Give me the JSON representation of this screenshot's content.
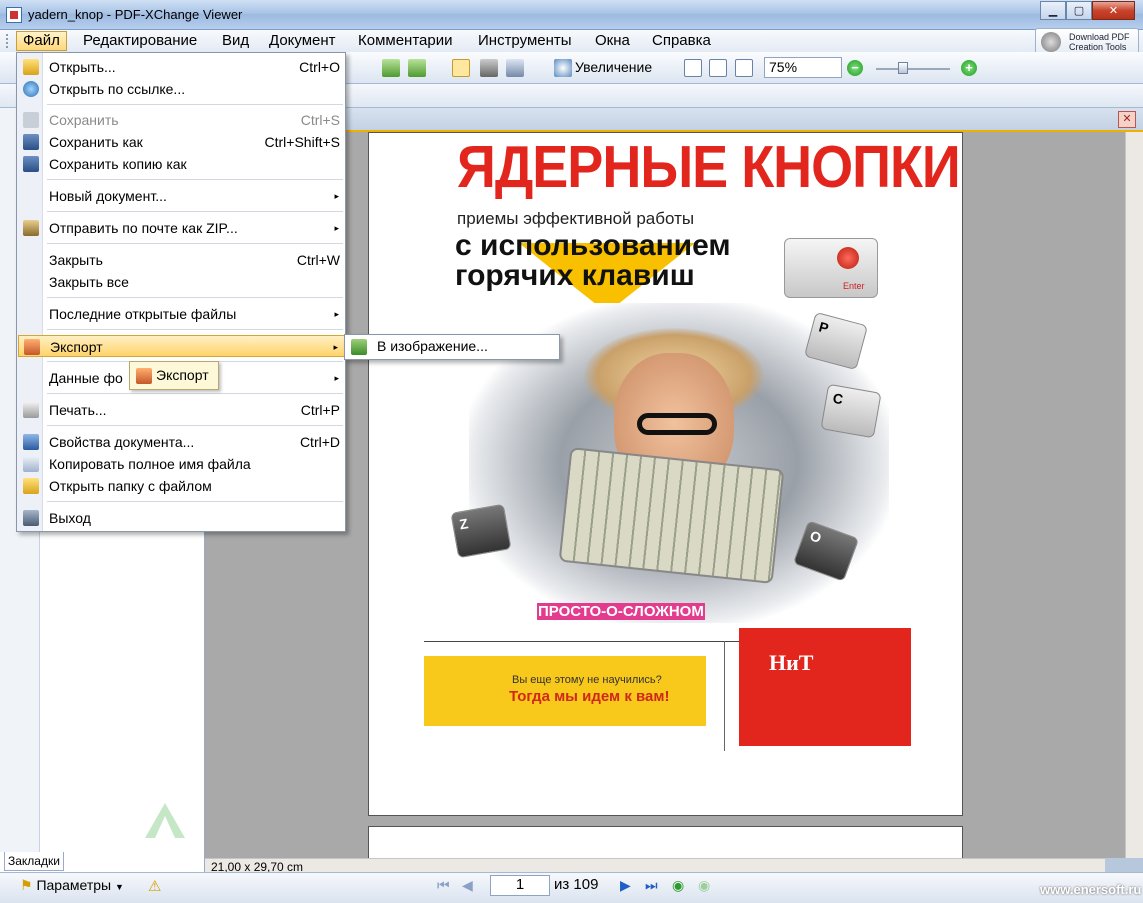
{
  "window": {
    "title": "yadern_knop - PDF-XChange Viewer"
  },
  "menubar": {
    "items": [
      "Файл",
      "Редактирование",
      "Вид",
      "Документ",
      "Комментарии",
      "Инструменты",
      "Окна",
      "Справка"
    ],
    "download_btn": [
      "Download PDF",
      "Creation Tools"
    ]
  },
  "toolbar": {
    "zoom_label": "Увеличение",
    "zoom_value": "75%"
  },
  "file_menu": {
    "items": [
      {
        "label": "Открыть...",
        "shortcut": "Ctrl+O"
      },
      {
        "label": "Открыть по ссылке..."
      },
      {
        "label": "Сохранить",
        "shortcut": "Ctrl+S"
      },
      {
        "label": "Сохранить как",
        "shortcut": "Ctrl+Shift+S"
      },
      {
        "label": "Сохранить копию как"
      },
      {
        "label": "Новый документ..."
      },
      {
        "label": "Отправить по почте как ZIP..."
      },
      {
        "label": "Закрыть",
        "shortcut": "Ctrl+W"
      },
      {
        "label": "Закрыть все"
      },
      {
        "label": "Последние открытые файлы"
      },
      {
        "label": "Экспорт"
      },
      {
        "label": "Данные фо"
      },
      {
        "label": "Печать...",
        "shortcut": "Ctrl+P"
      },
      {
        "label": "Свойства документа...",
        "shortcut": "Ctrl+D"
      },
      {
        "label": "Копировать полное имя файла"
      },
      {
        "label": "Открыть папку с файлом"
      },
      {
        "label": "Выход"
      }
    ],
    "export_submenu": "В изображение...",
    "tooltip": "Экспорт"
  },
  "left_pane": {
    "tab_label": "Закладки"
  },
  "document": {
    "title": "ЯДЕРНЫЕ КНОПКИ",
    "subtitle": "приемы эффективной работы",
    "line1": "с использованием",
    "line2": "горячих клавиш",
    "enter_key": "Enter",
    "series": "ПРОСТО-О-СЛОЖНОМ",
    "promo1": "Вы еще этому не научились?",
    "promo2": "Тогда мы идем к вам!",
    "publisher": "НиТ",
    "page_size": "21,00 x 29,70 cm"
  },
  "statusbar": {
    "params_label": "Параметры",
    "current_page": "1",
    "page_total": "из 109",
    "watermark": "www.enersoft.ru"
  },
  "colors": {
    "accent": "#ffd36a",
    "title_red": "#e3261d",
    "promo_yellow": "#f8c81a"
  }
}
